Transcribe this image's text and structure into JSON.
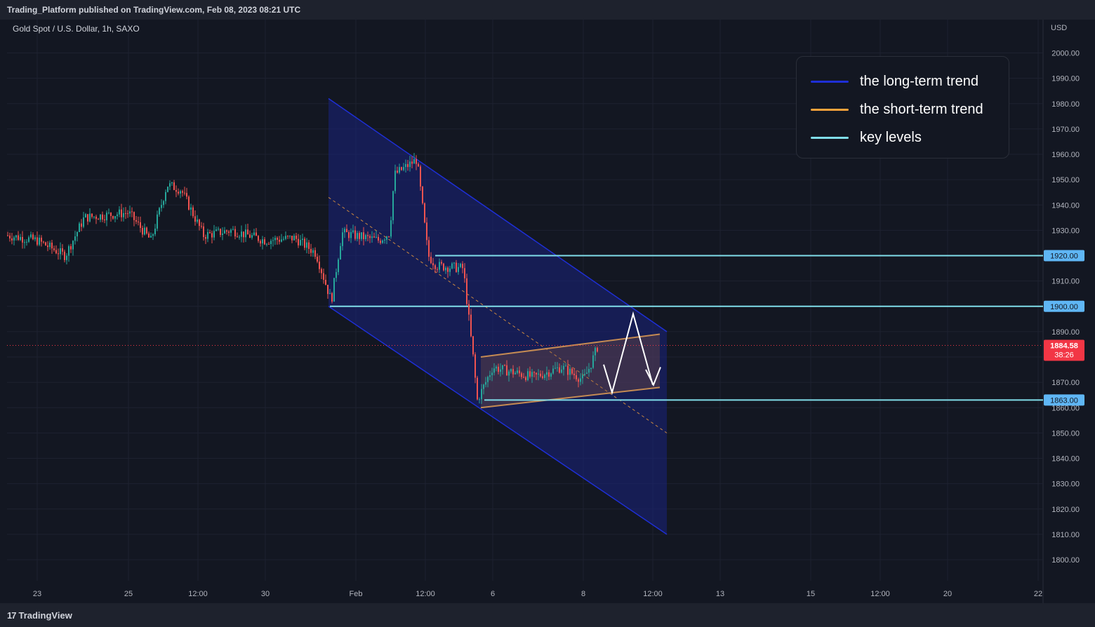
{
  "header": {
    "published": "Trading_Platform published on TradingView.com, Feb 08, 2023 08:21 UTC"
  },
  "chart": {
    "symbol": "Gold Spot / U.S. Dollar, 1h, SAXO",
    "currency": "USD"
  },
  "legend": {
    "items": [
      {
        "label": "the long-term trend",
        "color": "#1e2fd6"
      },
      {
        "label": "the short-term trend",
        "color": "#f7a23b"
      },
      {
        "label": "key levels",
        "color": "#80deea"
      }
    ]
  },
  "colors": {
    "background": "#131722",
    "up_candle": "#26a69a",
    "down_candle": "#ef5350",
    "channel_fill": "#1a237e",
    "key_level": "#80deea",
    "short_channel": "#c48a53",
    "price_badge": "#f23645",
    "level_badge": "#5fb6f5"
  },
  "footer": {
    "brand": "TradingView",
    "brand_mark": "17"
  },
  "chart_data": {
    "type": "candlestick",
    "title": "Gold Spot / U.S. Dollar, 1h, SAXO",
    "y_unit": "USD",
    "ylim": [
      1795,
      2010
    ],
    "y_ticks": [
      "2000.00",
      "1990.00",
      "1980.00",
      "1970.00",
      "1960.00",
      "1950.00",
      "1940.00",
      "1930.00",
      "1920.00",
      "1910.00",
      "1900.00",
      "1890.00",
      "1880.00",
      "1870.00",
      "1860.00",
      "1850.00",
      "1840.00",
      "1830.00",
      "1820.00",
      "1810.00",
      "1800.00"
    ],
    "x_ticks": [
      "23",
      "25",
      "12:00",
      "30",
      "Feb",
      "12:00",
      "6",
      "8",
      "12:00",
      "13",
      "15",
      "12:00",
      "20",
      "22"
    ],
    "current_price": {
      "value": "1884.58",
      "countdown": "38:26"
    },
    "key_levels": [
      {
        "value": 1920,
        "label": "1920.00"
      },
      {
        "value": 1900,
        "label": "1900.00"
      },
      {
        "value": 1863,
        "label": "1863.00"
      }
    ],
    "price_path": [
      {
        "t": "Jan 20",
        "price": 1928
      },
      {
        "t": "Jan 23",
        "price": 1926
      },
      {
        "t": "Jan 23 12:00",
        "price": 1920
      },
      {
        "t": "Jan 24",
        "price": 1935
      },
      {
        "t": "Jan 25",
        "price": 1937
      },
      {
        "t": "Jan 25 12:00",
        "price": 1926
      },
      {
        "t": "Jan 26",
        "price": 1948
      },
      {
        "t": "Jan 26 12:00",
        "price": 1946
      },
      {
        "t": "Jan 27",
        "price": 1928
      },
      {
        "t": "Jan 29",
        "price": 1930
      },
      {
        "t": "Jan 30",
        "price": 1926
      },
      {
        "t": "Jan 31",
        "price": 1927
      },
      {
        "t": "Jan 31 12:00",
        "price": 1921
      },
      {
        "t": "Feb 1",
        "price": 1902
      },
      {
        "t": "Feb 1 08:00",
        "price": 1929
      },
      {
        "t": "Feb 1 18:00",
        "price": 1926
      },
      {
        "t": "Feb 2",
        "price": 1929
      },
      {
        "t": "Feb 2 03:00",
        "price": 1952
      },
      {
        "t": "Feb 2 12:00",
        "price": 1958
      },
      {
        "t": "Feb 2 14:00",
        "price": 1920
      },
      {
        "t": "Feb 2 20:00",
        "price": 1916
      },
      {
        "t": "Feb 3",
        "price": 1915
      },
      {
        "t": "Feb 3 02:00",
        "price": 1880
      },
      {
        "t": "Feb 3 08:00",
        "price": 1863
      },
      {
        "t": "Feb 6",
        "price": 1876
      },
      {
        "t": "Feb 6 12:00",
        "price": 1872
      },
      {
        "t": "Feb 7",
        "price": 1876
      },
      {
        "t": "Feb 7 12:00",
        "price": 1871
      },
      {
        "t": "Feb 8",
        "price": 1876
      },
      {
        "t": "Feb 8 08:00",
        "price": 1884.58
      }
    ]
  }
}
